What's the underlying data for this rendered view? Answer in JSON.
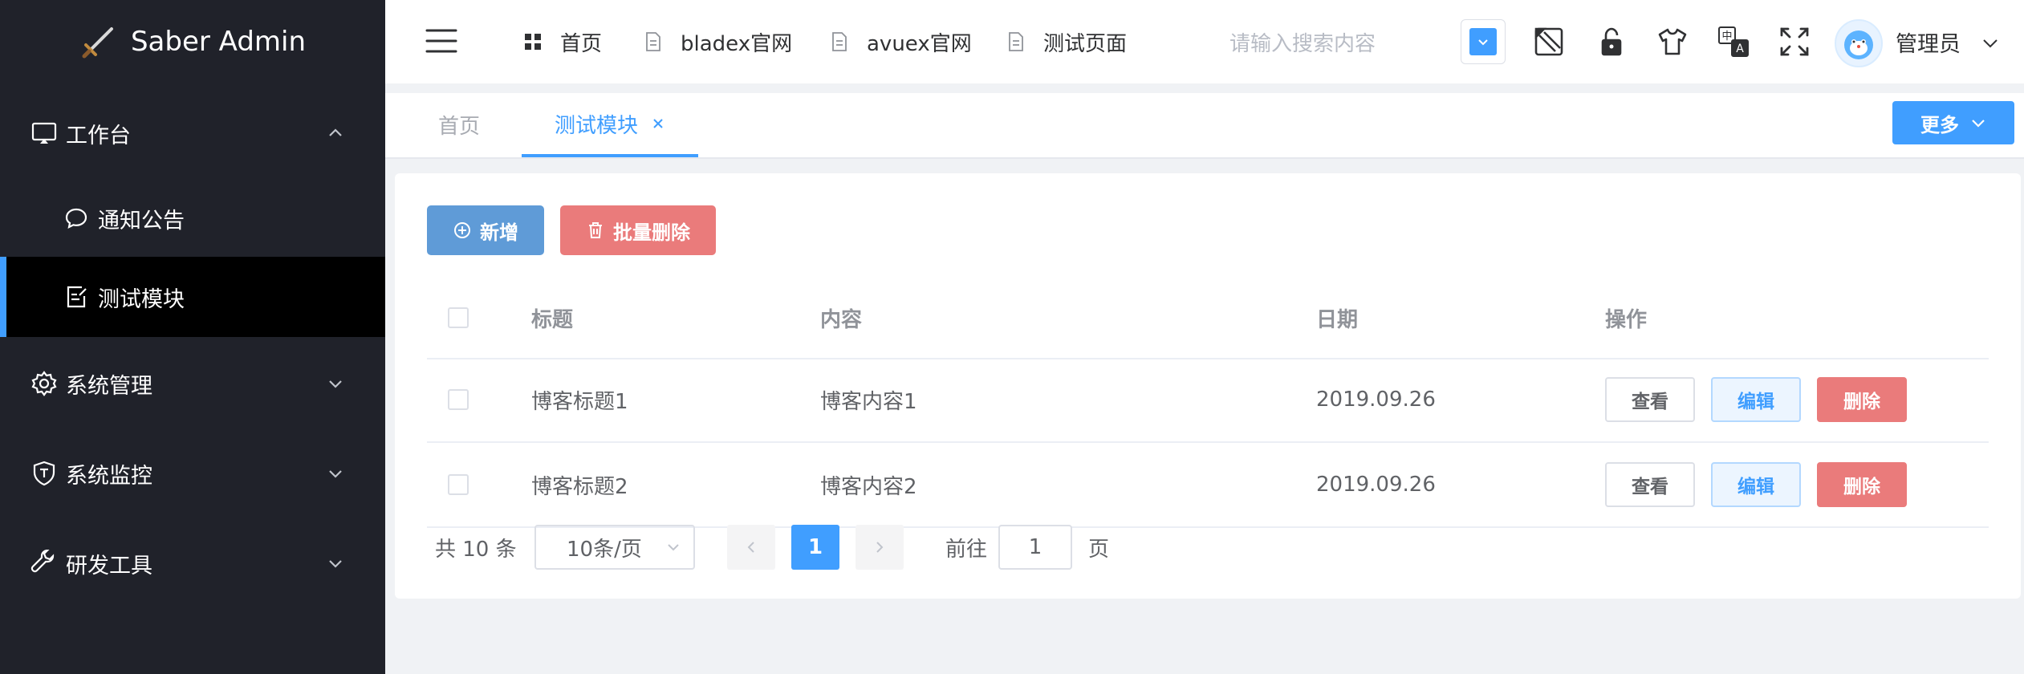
{
  "app": {
    "title": "Saber Admin"
  },
  "sidebar": {
    "items": [
      {
        "label": "工作台",
        "icon": "monitor-icon",
        "expanded": true,
        "children": [
          {
            "label": "通知公告",
            "icon": "chat-icon"
          },
          {
            "label": "测试模块",
            "icon": "edit-doc-icon",
            "active": true
          }
        ]
      },
      {
        "label": "系统管理",
        "icon": "gear-icon"
      },
      {
        "label": "系统监控",
        "icon": "shield-icon"
      },
      {
        "label": "研发工具",
        "icon": "wrench-icon"
      }
    ]
  },
  "header": {
    "nav": [
      {
        "label": "首页",
        "icon": "grid-icon"
      },
      {
        "label": "bladex官网",
        "icon": "document-icon"
      },
      {
        "label": "avuex官网",
        "icon": "document-icon"
      },
      {
        "label": "测试页面",
        "icon": "document-icon"
      }
    ],
    "search_placeholder": "请输入搜索内容",
    "theme_color": "#409eff",
    "user_name": "管理员"
  },
  "tags": {
    "items": [
      {
        "label": "首页",
        "active": false
      },
      {
        "label": "测试模块",
        "active": true,
        "closable": true
      }
    ],
    "more_label": "更多"
  },
  "toolbar": {
    "add_label": "新增",
    "batch_delete_label": "批量删除"
  },
  "table": {
    "columns": [
      "标题",
      "内容",
      "日期",
      "操作"
    ],
    "rows": [
      {
        "title": "博客标题1",
        "content": "博客内容1",
        "date": "2019.09.26"
      },
      {
        "title": "博客标题2",
        "content": "博客内容2",
        "date": "2019.09.26"
      }
    ],
    "actions": {
      "view": "查看",
      "edit": "编辑",
      "delete": "删除"
    }
  },
  "pagination": {
    "total_text": "共 10 条",
    "page_size": "10条/页",
    "current_page": "1",
    "goto_label": "前往",
    "goto_value": "1",
    "page_unit": "页"
  },
  "colors": {
    "primary": "#409eff",
    "danger": "#f56c6c",
    "sidebar_bg": "#20222a"
  }
}
